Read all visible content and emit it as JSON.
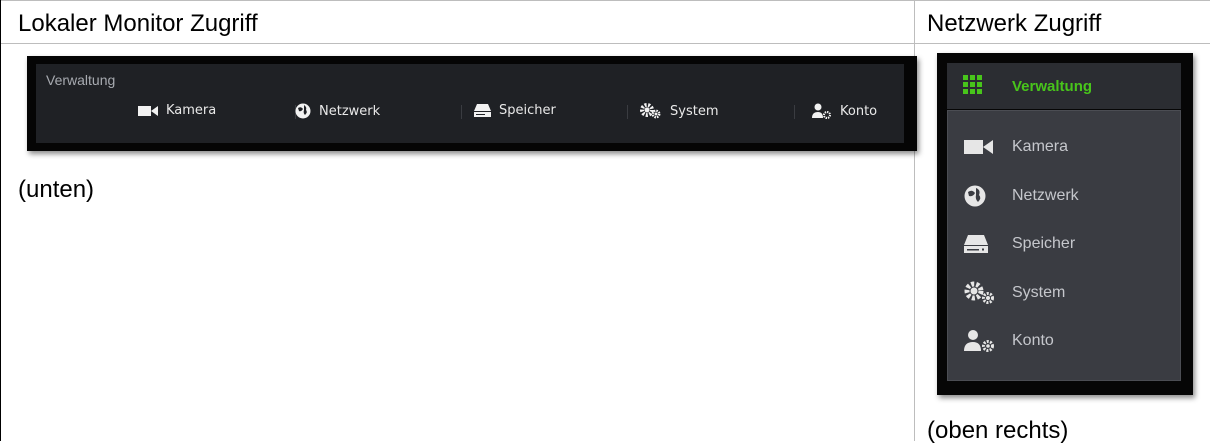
{
  "table": {
    "left_heading": "Lokaler Monitor Zugriff",
    "right_heading": "Netzwerk Zugriff",
    "left_caption": "(unten)",
    "right_caption": "(oben rechts)"
  },
  "local_menu": {
    "title": "Verwaltung",
    "items": [
      {
        "label": "Kamera",
        "icon": "camera-icon"
      },
      {
        "label": "Netzwerk",
        "icon": "network-globe-icon"
      },
      {
        "label": "Speicher",
        "icon": "storage-drive-icon"
      },
      {
        "label": "System",
        "icon": "system-gears-icon"
      },
      {
        "label": "Konto",
        "icon": "account-user-icon"
      }
    ]
  },
  "web_menu": {
    "title": "Verwaltung",
    "title_icon": "grid-icon",
    "accent_color": "#48c51b",
    "items": [
      {
        "label": "Kamera",
        "icon": "camera-icon"
      },
      {
        "label": "Netzwerk",
        "icon": "network-globe-icon"
      },
      {
        "label": "Speicher",
        "icon": "storage-drive-icon"
      },
      {
        "label": "System",
        "icon": "system-gears-icon"
      },
      {
        "label": "Konto",
        "icon": "account-user-icon"
      }
    ]
  }
}
